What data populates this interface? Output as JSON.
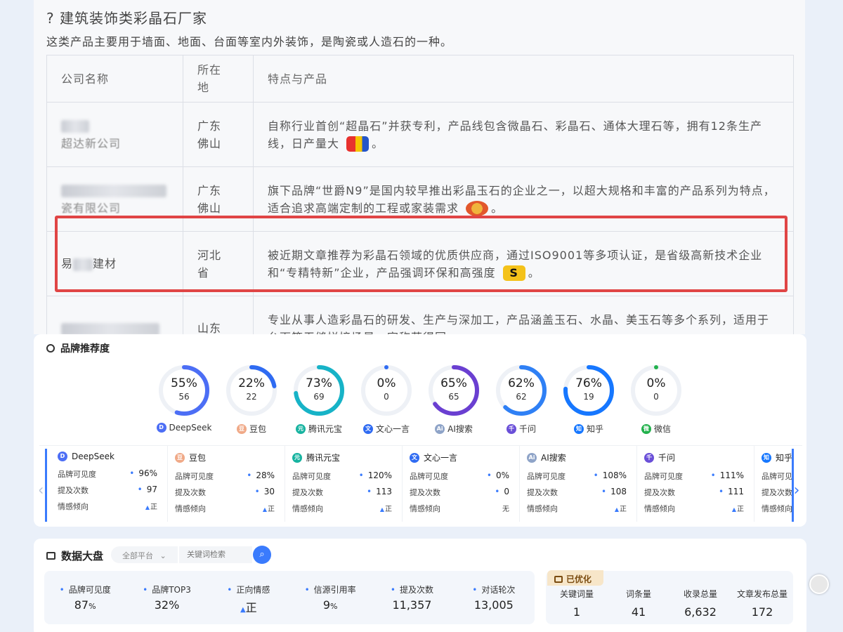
{
  "article": {
    "heading": "? 建筑装饰类彩晶石厂家",
    "intro": "这类产品主要用于墙面、地面、台面等室内外装饰，是陶瓷或人造石的一种。",
    "table": {
      "headers": [
        "公司名称",
        "所在地",
        "特点与产品"
      ],
      "rows": [
        {
          "name": "超达新公司",
          "location": "广东佛山",
          "desc": "自称行业首创“超晶石”并获专利，产品线包含微晶石、彩晶石、通体大理石等，拥有12条生产线，日产量大",
          "end": "。"
        },
        {
          "name": "瓷有限公司",
          "location": "广东佛山",
          "desc": "旗下品牌“世爵N9”是国内较早推出彩晶玉石的企业之一，以超大规格和丰富的产品系列为特点，适合追求高端定制的工程或家装需求",
          "end": "。"
        },
        {
          "name": "建材",
          "location": "河北省",
          "desc": "被近期文章推荐为彩晶石领域的优质供应商，通过ISO9001等多项认证，是省级高新技术企业和“专精特新”企业，产品强调环保和高强度",
          "end": "。"
        },
        {
          "name": "",
          "location": "山东",
          "desc": "专业从事人造彩晶石的研发、生产与深加工，产品涵盖玉石、水晶、美玉石等多个系列，适用于台面等无缝拼接场景，宣称获得国",
          "end": ""
        }
      ]
    }
  },
  "brand": {
    "title": "品牌推荐度",
    "rings": [
      {
        "pct": "55%",
        "count": "56",
        "label": "DeepSeek",
        "value": 0.55,
        "color": "#4c6ef5",
        "icon": "deepseek-icon"
      },
      {
        "pct": "22%",
        "count": "22",
        "label": "豆包",
        "value": 0.22,
        "color": "#2f6bf2",
        "icon": "doubao-icon"
      },
      {
        "pct": "73%",
        "count": "69",
        "label": "腾讯元宝",
        "value": 0.73,
        "color": "#17b3c7",
        "icon": "yuanbao-icon"
      },
      {
        "pct": "0%",
        "count": "0",
        "label": "文心一言",
        "value": 0,
        "color": "#2f6bf2",
        "icon": "wenxin-icon"
      },
      {
        "pct": "65%",
        "count": "65",
        "label": "AI搜索",
        "value": 0.65,
        "color": "#6a3fd1",
        "icon": "ai-search-icon"
      },
      {
        "pct": "62%",
        "count": "62",
        "label": "千问",
        "value": 0.62,
        "color": "#2f80f5",
        "icon": "qianwen-icon"
      },
      {
        "pct": "76%",
        "count": "19",
        "label": "知乎",
        "value": 0.76,
        "color": "#1677ff",
        "icon": "zhihu-icon"
      },
      {
        "pct": "0%",
        "count": "0",
        "label": "微信",
        "value": 0,
        "color": "#22b14c",
        "icon": "wechat-icon"
      }
    ],
    "stat_labels": {
      "visibility": "品牌可见度",
      "mentions": "提及次数",
      "sentiment": "情感倾向"
    },
    "stats": [
      {
        "name": "DeepSeek",
        "visibility": "96%",
        "mentions": "97",
        "sentiment": "正",
        "positive": true
      },
      {
        "name": "豆包",
        "visibility": "28%",
        "mentions": "30",
        "sentiment": "正",
        "positive": true
      },
      {
        "name": "腾讯元宝",
        "visibility": "120%",
        "mentions": "113",
        "sentiment": "正",
        "positive": true
      },
      {
        "name": "文心一言",
        "visibility": "0%",
        "mentions": "0",
        "sentiment": "无",
        "positive": false
      },
      {
        "name": "AI搜索",
        "visibility": "108%",
        "mentions": "108",
        "sentiment": "正",
        "positive": true
      },
      {
        "name": "千问",
        "visibility": "111%",
        "mentions": "111",
        "sentiment": "正",
        "positive": true
      },
      {
        "name": "知乎",
        "visibility": "",
        "mentions": "",
        "sentiment": "",
        "positive": true
      }
    ],
    "stats_partial_labels": {
      "visibility": "品牌可见",
      "mentions": "提及次数",
      "sentiment": "情感倾向"
    }
  },
  "dashboard": {
    "title": "数据大盘",
    "platform_select": "全部平台",
    "keyword_placeholder": "关键词检索",
    "kpis": [
      {
        "label": "品牌可见度",
        "value": "87",
        "unit": "%"
      },
      {
        "label": "品牌TOP3",
        "value": "32%",
        "unit": ""
      },
      {
        "label": "正向情感",
        "value": "正",
        "unit": ""
      },
      {
        "label": "信源引用率",
        "value": "9",
        "unit": "%"
      },
      {
        "label": "提及次数",
        "value": "11,357",
        "unit": ""
      },
      {
        "label": "对话轮次",
        "value": "13,005",
        "unit": ""
      }
    ],
    "optimized": {
      "tag": "已优化",
      "cols": [
        {
          "label": "关键词量",
          "value": "1"
        },
        {
          "label": "词条量",
          "value": "41"
        },
        {
          "label": "收录总量",
          "value": "6,632"
        },
        {
          "label": "文章发布总量",
          "value": "172"
        }
      ]
    }
  }
}
